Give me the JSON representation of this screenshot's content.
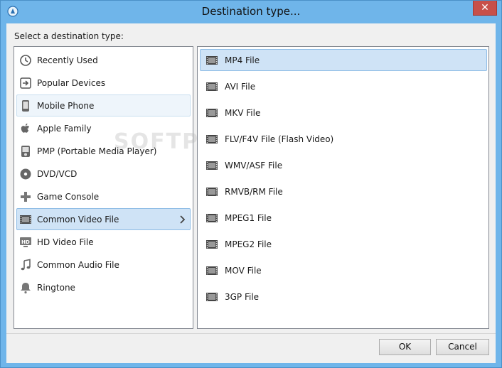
{
  "window": {
    "title": "Destination type...",
    "close_glyph": "✕"
  },
  "prompt": "Select a destination type:",
  "watermark": "SOFTPEDIA",
  "categories": [
    {
      "label": "Recently Used",
      "icon": "clock-icon"
    },
    {
      "label": "Popular Devices",
      "icon": "arrow-box-icon"
    },
    {
      "label": "Mobile Phone",
      "icon": "phone-icon",
      "state": "hovered"
    },
    {
      "label": "Apple Family",
      "icon": "apple-icon"
    },
    {
      "label": "PMP (Portable Media Player)",
      "icon": "pmp-icon"
    },
    {
      "label": "DVD/VCD",
      "icon": "disc-icon"
    },
    {
      "label": "Game Console",
      "icon": "gamepad-icon"
    },
    {
      "label": "Common Video File",
      "icon": "film-icon",
      "state": "selected"
    },
    {
      "label": "HD Video File",
      "icon": "hd-icon"
    },
    {
      "label": "Common Audio File",
      "icon": "music-note-icon"
    },
    {
      "label": "Ringtone",
      "icon": "bell-icon"
    }
  ],
  "formats": [
    {
      "label": "MP4 File",
      "state": "selected"
    },
    {
      "label": "AVI File"
    },
    {
      "label": "MKV File"
    },
    {
      "label": "FLV/F4V File (Flash Video)"
    },
    {
      "label": "WMV/ASF File"
    },
    {
      "label": "RMVB/RM File"
    },
    {
      "label": "MPEG1 File"
    },
    {
      "label": "MPEG2 File"
    },
    {
      "label": "MOV File"
    },
    {
      "label": "3GP File"
    }
  ],
  "buttons": {
    "ok": "OK",
    "cancel": "Cancel"
  },
  "colors": {
    "titlebar": "#6fb5ea",
    "selection": "#cfe3f6",
    "close": "#c7504a"
  }
}
